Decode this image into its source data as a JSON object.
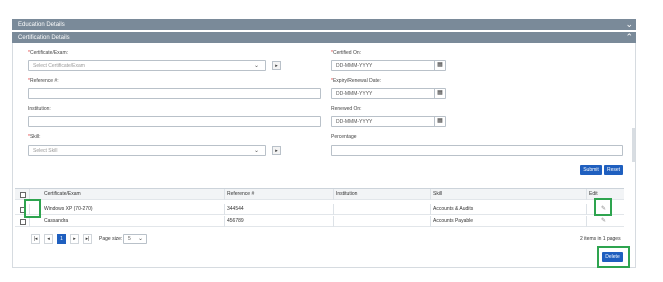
{
  "sections": {
    "education": "Education Details",
    "certification": "Certification Details"
  },
  "form": {
    "certificate_label": "Certificate/Exam:",
    "certificate_placeholder": "Select Certificate/Exam",
    "reference_label": "Reference #:",
    "institution_label": "Institution:",
    "skill_label": "Skill:",
    "skill_placeholder": "Select Skill",
    "certified_on_label": "Certified On:",
    "expiry_label": "Expiry/Renewal Date:",
    "renewed_on_label": "Renewed On:",
    "percentage_label": "Percentage",
    "date_placeholder": "DD-MMM-YYYY",
    "asterisk": "*",
    "add_glyph": "▸"
  },
  "buttons": {
    "submit": "Submit",
    "reset": "Reset",
    "delete": "Delete"
  },
  "table": {
    "columns": [
      "Certificate/Exam",
      "Reference #",
      "Institution",
      "Skill",
      "Edit"
    ],
    "rows": [
      {
        "certificate": "Windows XP (70-270)",
        "reference": "344544",
        "institution": "",
        "skill": "Accounts & Audits"
      },
      {
        "certificate": "Cassandra",
        "reference": "456789",
        "institution": "",
        "skill": "Accounts Payable"
      }
    ]
  },
  "pager": {
    "first": "|◂",
    "prev": "◂",
    "current": "1",
    "next": "▸",
    "last": "▸|",
    "page_size_label": "Page size:",
    "page_size": "5",
    "summary": "2 items in 1 pages"
  },
  "icons": {
    "chevron_down": "chevron-down-icon",
    "chevron_up": "chevron-up-icon",
    "calendar": "calendar-icon",
    "edit": "edit-icon"
  },
  "colors": {
    "header_bg": "#7a8a99",
    "button_blue": "#1f5fbf",
    "highlight_green": "#2ea44f"
  }
}
